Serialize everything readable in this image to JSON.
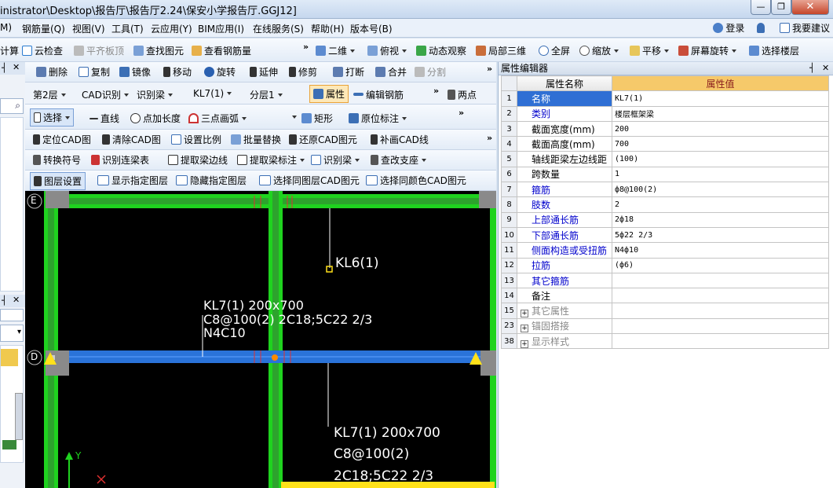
{
  "window": {
    "title": "inistrator\\Desktop\\报告厅\\报告厅2.24\\保安小学报告厅.GGJ12]",
    "min": "—",
    "max": "❐",
    "close": "✕"
  },
  "menu": {
    "items": [
      "M)",
      "钢筋量(Q)",
      "视图(V)",
      "工具(T)",
      "云应用(Y)",
      "BIM应用(I)",
      "在线服务(S)",
      "帮助(H)",
      "版本号(B)"
    ],
    "login": "登录",
    "feedback": "我要建议"
  },
  "toolbar1": {
    "calc": "计算",
    "cloud_check": "云检查",
    "flat_board": "平齐板顶",
    "find_elem": "查找图元",
    "view_rebar": "查看钢筋量",
    "view2d": "二维",
    "plan_view": "俯视",
    "dynamic": "动态观察",
    "local3d": "局部三维",
    "fullscreen": "全屏",
    "zoom": "缩放",
    "pan": "平移",
    "rotate_screen": "屏幕旋转",
    "select_floor": "选择楼层"
  },
  "toolbar2": {
    "delete": "删除",
    "copy": "复制",
    "mirror": "镜像",
    "move": "移动",
    "rotate": "旋转",
    "extend": "延伸",
    "trim": "修剪",
    "break": "打断",
    "merge": "合并",
    "split": "分割"
  },
  "toolbar3": {
    "floor": "第2层",
    "cad_recog": "CAD识别",
    "recog_beam": "识别梁",
    "beam_name": "KL7(1)",
    "layer": "分层1",
    "property": "属性",
    "edit_rebar": "编辑钢筋",
    "two_point": "两点"
  },
  "toolbar4": {
    "select": "选择",
    "line": "直线",
    "point_length": "点加长度",
    "three_arc": "三点画弧",
    "rect": "矩形",
    "origin_mark": "原位标注"
  },
  "toolbar5": {
    "locate_cad": "定位CAD图",
    "clear_cad": "清除CAD图",
    "set_scale": "设置比例",
    "batch_replace": "批量替换",
    "restore_cad": "还原CAD图元",
    "fill_cad": "补画CAD线"
  },
  "toolbar6": {
    "convert_symbol": "转换符号",
    "recog_beam_table": "识别连梁表",
    "extract_edge": "提取梁边线",
    "extract_mark": "提取梁标注",
    "recog_beam": "识别梁",
    "check_support": "查改支座"
  },
  "toolbar7": {
    "layer_settings": "图层设置",
    "show_layer": "显示指定图层",
    "hide_layer": "隐藏指定图层",
    "select_same_layer": "选择同图层CAD图元",
    "select_same_color": "选择同颜色CAD图元"
  },
  "cad": {
    "axis_e": "E",
    "axis_d": "D",
    "label_kl6": "KL6(1)",
    "label_kl7_a_line1": "KL7(1) 200x700",
    "label_kl7_a_line2": "C8@100(2) 2C18;5C22 2/3",
    "label_kl7_a_line3": "N4C10",
    "label_kl7_b_line1": "KL7(1) 200x700",
    "label_kl7_b_line2": "C8@100(2)",
    "label_kl7_b_line3": "2C18;5C22 2/3",
    "y_axis": "Y"
  },
  "properties": {
    "panel_title": "属性编辑器",
    "col_name": "属性名称",
    "col_value": "属性值",
    "rows": [
      {
        "no": "1",
        "name": "名称",
        "value": "KL7(1)"
      },
      {
        "no": "2",
        "name": "类别",
        "value": "楼层框架梁"
      },
      {
        "no": "3",
        "name": "截面宽度(mm)",
        "value": "200"
      },
      {
        "no": "4",
        "name": "截面高度(mm)",
        "value": "700"
      },
      {
        "no": "5",
        "name": "轴线距梁左边线距",
        "value": "(100)"
      },
      {
        "no": "6",
        "name": "跨数量",
        "value": "1"
      },
      {
        "no": "7",
        "name": "箍筋",
        "value": "ф8@100(2)"
      },
      {
        "no": "8",
        "name": "肢数",
        "value": "2"
      },
      {
        "no": "9",
        "name": "上部通长筋",
        "value": "2ф18"
      },
      {
        "no": "10",
        "name": "下部通长筋",
        "value": "5ф22 2/3"
      },
      {
        "no": "11",
        "name": "侧面构造或受扭筋",
        "value": "N4ф10"
      },
      {
        "no": "12",
        "name": "拉筋",
        "value": "(ф6)"
      },
      {
        "no": "13",
        "name": "其它箍筋",
        "value": ""
      },
      {
        "no": "14",
        "name": "备注",
        "value": ""
      },
      {
        "no": "15",
        "name": "其它属性",
        "value": ""
      },
      {
        "no": "23",
        "name": "锚固搭接",
        "value": ""
      },
      {
        "no": "38",
        "name": "显示样式",
        "value": ""
      }
    ]
  }
}
